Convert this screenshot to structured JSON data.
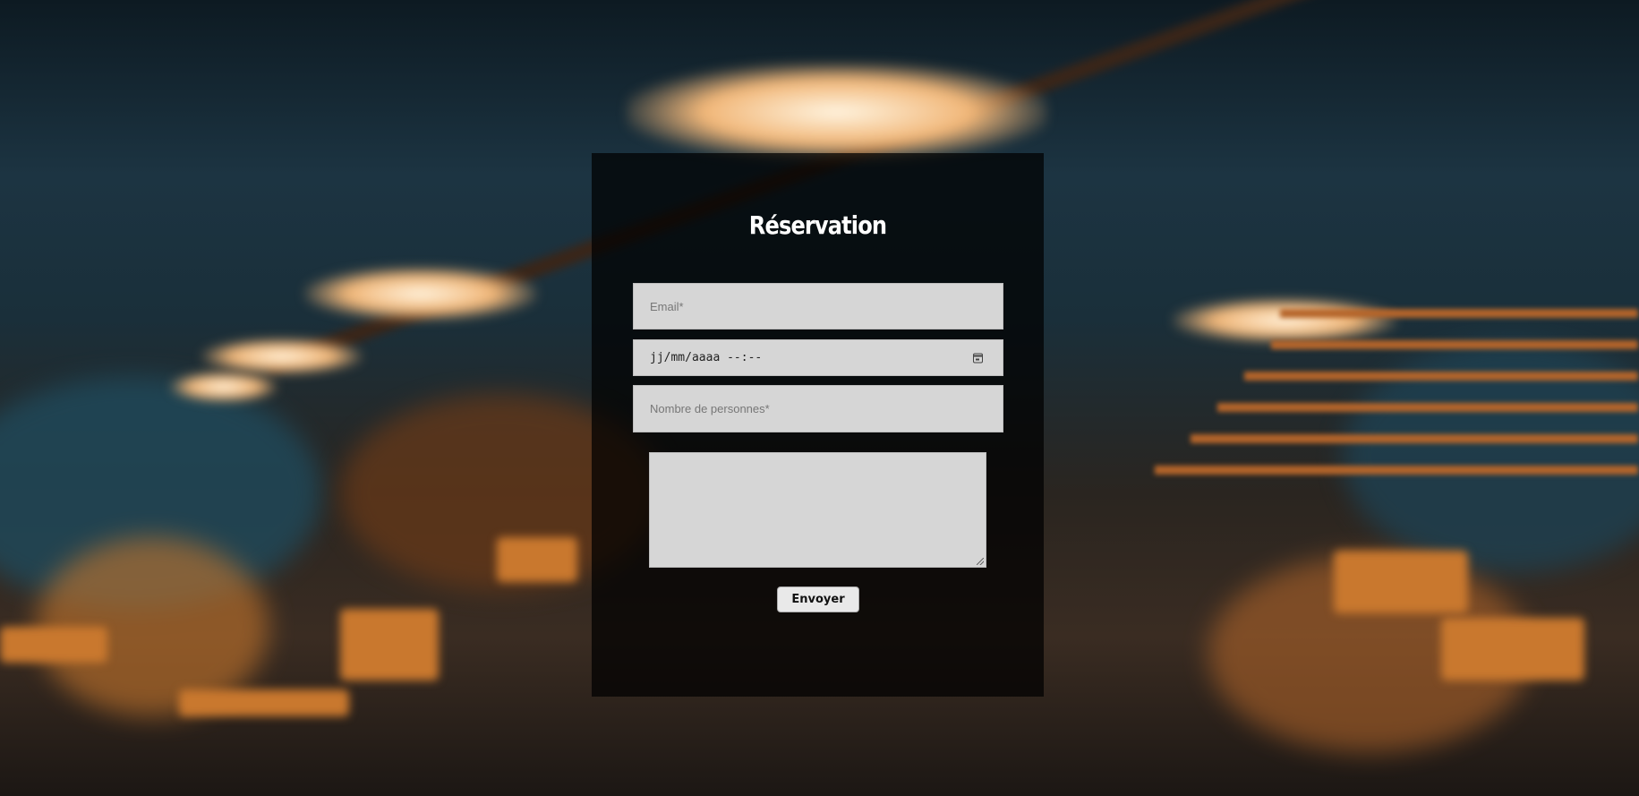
{
  "form": {
    "title": "Réservation",
    "email_placeholder": "Email*",
    "datetime_placeholder": "jj/mm/aaaa --:--",
    "people_placeholder": "Nombre de personnes*",
    "message_value": "",
    "submit_label": "Envoyer"
  },
  "icons": {
    "calendar": "calendar-icon"
  },
  "colors": {
    "card_background": "#000000",
    "field_background": "#d6d6d6",
    "title": "#ffffff"
  }
}
